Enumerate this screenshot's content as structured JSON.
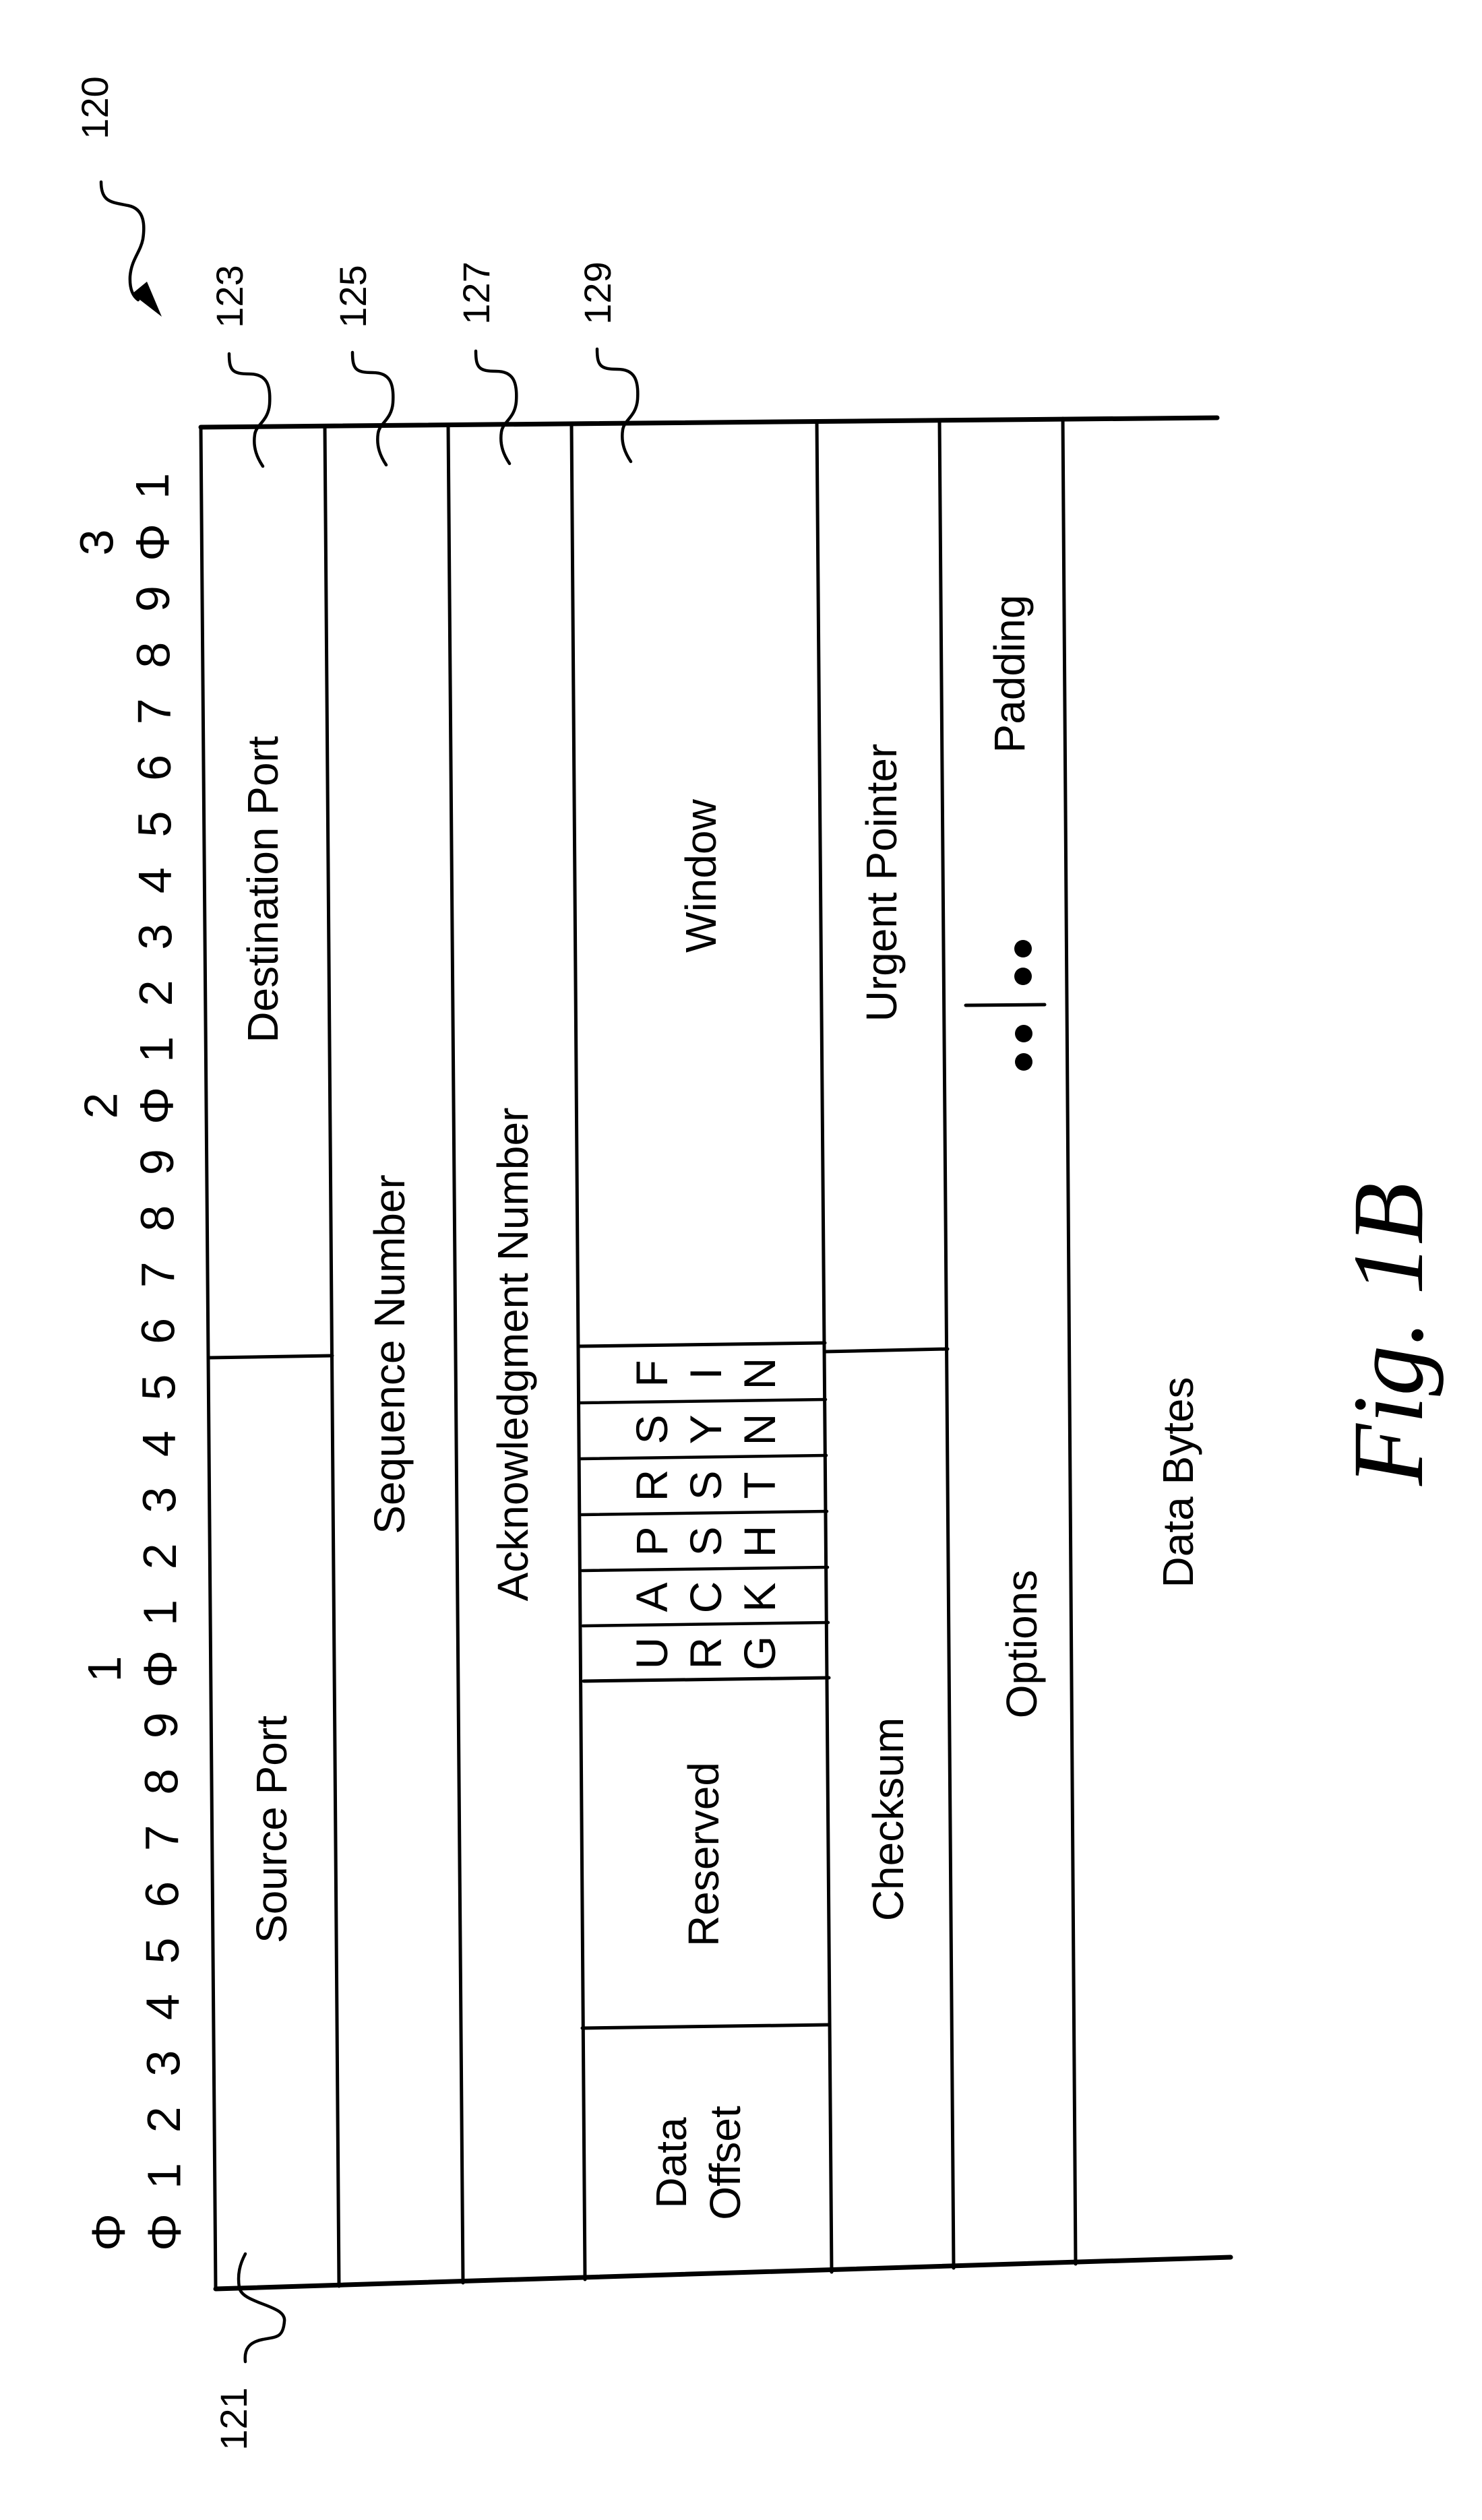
{
  "figure": {
    "label": "Fig. 1B",
    "reference_numerals": {
      "header": "120",
      "source_port": "121",
      "destination_port": "123",
      "sequence_number": "125",
      "acknowledgment_number": "127",
      "window": "129"
    }
  },
  "bit_ruler": {
    "tens": [
      "Φ",
      "1",
      "2",
      "3"
    ],
    "units": [
      "Φ",
      "1",
      "2",
      "3",
      "4",
      "5",
      "6",
      "7",
      "8",
      "9",
      "Φ",
      "1",
      "2",
      "3",
      "4",
      "5",
      "6",
      "7",
      "8",
      "9",
      "Φ",
      "1",
      "2",
      "3",
      "4",
      "5",
      "6",
      "7",
      "8",
      "9",
      "Φ",
      "1"
    ]
  },
  "fields": {
    "source_port": "Source Port",
    "destination_port": "Destination Port",
    "sequence_number": "Sequence Number",
    "acknowledgment_number": "Acknowledgment Number",
    "data_offset_line1": "Data",
    "data_offset_line2": "Offset",
    "reserved": "Reserved",
    "window": "Window",
    "checksum": "Checksum",
    "urgent_pointer": "Urgent Pointer",
    "options": "Options",
    "padding": "Padding",
    "data_bytes": "Data Bytes"
  },
  "flags": [
    {
      "name": "URG",
      "letters": [
        "U",
        "R",
        "G"
      ]
    },
    {
      "name": "ACK",
      "letters": [
        "A",
        "C",
        "K"
      ]
    },
    {
      "name": "PSH",
      "letters": [
        "P",
        "S",
        "H"
      ]
    },
    {
      "name": "RST",
      "letters": [
        "R",
        "S",
        "T"
      ]
    },
    {
      "name": "SYN",
      "letters": [
        "S",
        "Y",
        "N"
      ]
    },
    {
      "name": "FIN",
      "letters": [
        "F",
        "I",
        "N"
      ]
    }
  ]
}
